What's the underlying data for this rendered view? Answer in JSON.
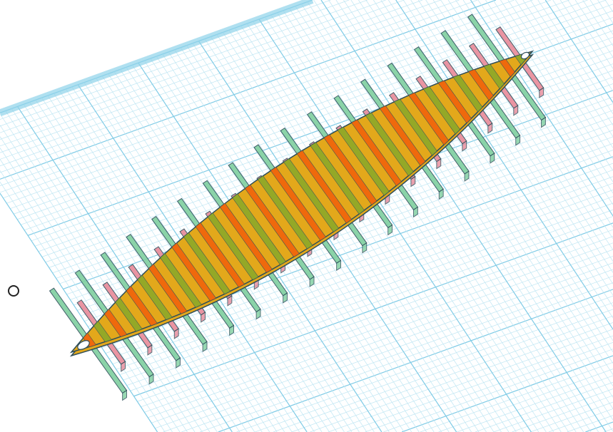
{
  "scene": {
    "colors": {
      "background": "#ffffff",
      "grid_minor": "#bfe6f3",
      "grid_major": "#7fcbe6",
      "plane_edge": "#8fd3ea",
      "slat_green": "#7fcf9f",
      "slat_pink": "#e88a99",
      "lens_yellow": "#e3a81b",
      "lens_orange": "#f0620c",
      "lens_green": "#86a82a",
      "outline": "#2e4e5a"
    },
    "slat_count": 34
  },
  "icons": {
    "origin_marker": "circle-marker-icon"
  }
}
